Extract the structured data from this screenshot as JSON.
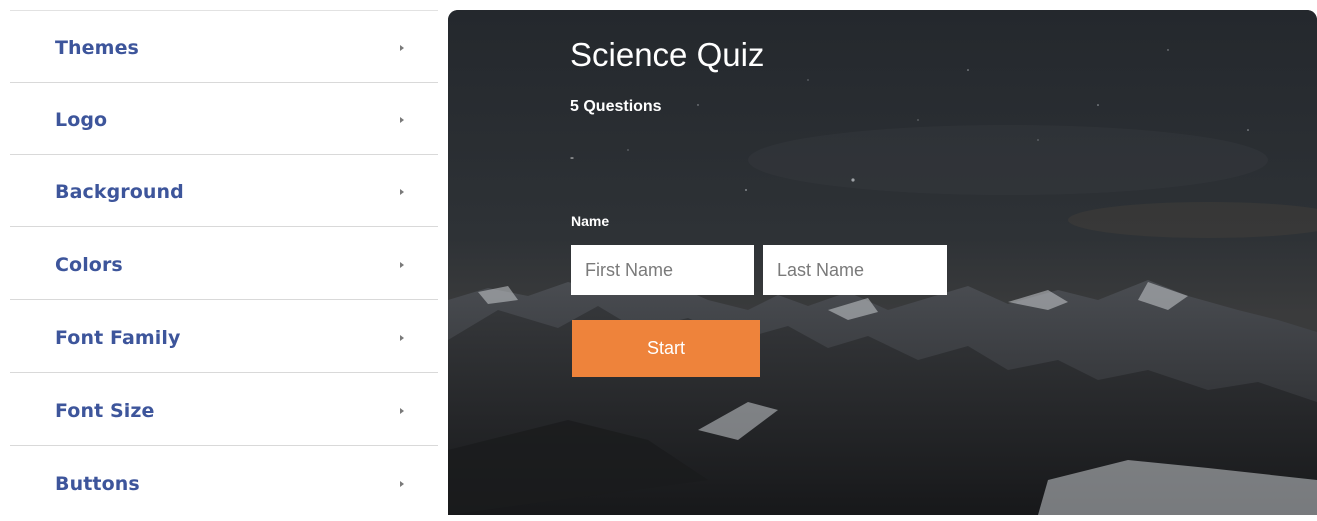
{
  "sidebar": {
    "items": [
      {
        "label": "Themes",
        "icon": "chevron-right-icon"
      },
      {
        "label": "Logo",
        "icon": "chevron-right-icon"
      },
      {
        "label": "Background",
        "icon": "chevron-right-icon"
      },
      {
        "label": "Colors",
        "icon": "chevron-right-icon"
      },
      {
        "label": "Font Family",
        "icon": "chevron-right-icon"
      },
      {
        "label": "Font Size",
        "icon": "chevron-right-icon"
      },
      {
        "label": "Buttons",
        "icon": "chevron-right-icon"
      }
    ]
  },
  "preview": {
    "title": "Science Quiz",
    "subtitle": "5 Questions",
    "description": "-",
    "name_label": "Name",
    "first_name_placeholder": "First Name",
    "first_name_value": "",
    "last_name_placeholder": "Last Name",
    "last_name_value": "",
    "start_label": "Start",
    "background_image": "night-sky-mountains"
  },
  "colors": {
    "sidebar_text": "#3d559b",
    "start_button": "#ee833b",
    "divider": "#d9d9d9"
  }
}
